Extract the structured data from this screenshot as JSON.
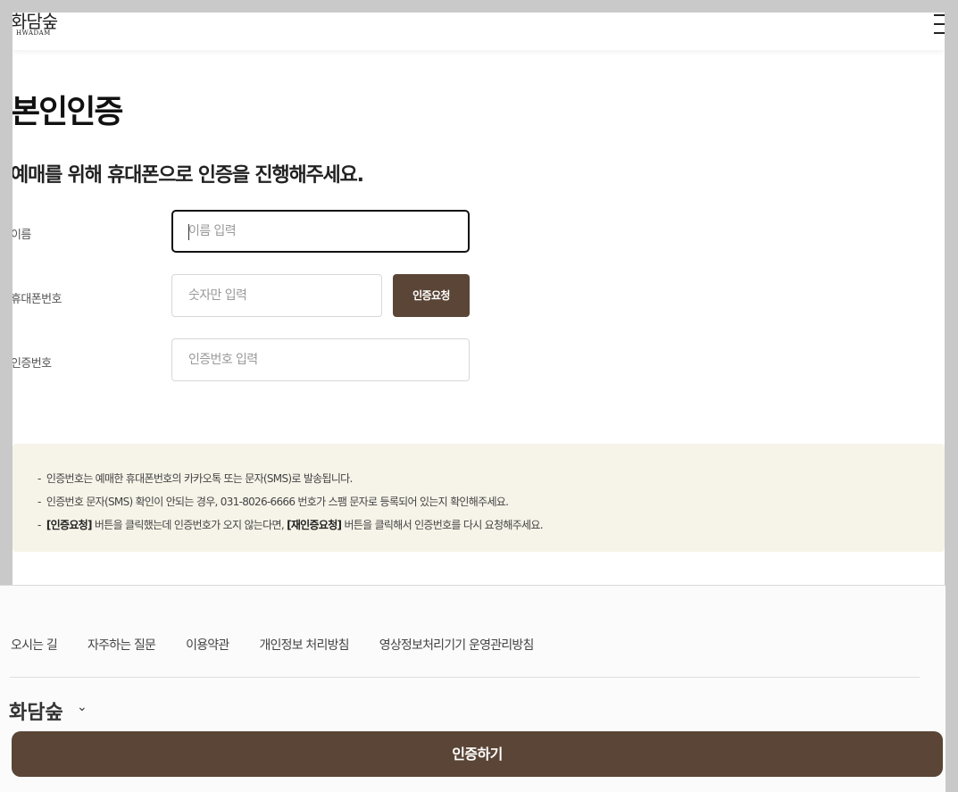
{
  "header": {
    "logo_text": "화담숲",
    "logo_sub": "HWADAM",
    "menu_icon": "hamburger-icon"
  },
  "page": {
    "title": "본인인증",
    "subtitle": "예매를 위해 휴대폰으로 인증을 진행해주세요."
  },
  "form": {
    "name_label": "이름",
    "name_placeholder": "이름 입력",
    "phone_label": "휴대폰번호",
    "phone_placeholder": "숫자만 입력",
    "request_button": "인증요청",
    "code_label": "인증번호",
    "code_placeholder": "인증번호 입력"
  },
  "notice": {
    "line1": "인증번호는 예매한 휴대폰번호의 카카오톡 또는 문자(SMS)로 발송됩니다.",
    "line2": "인증번호 문자(SMS) 확인이 안되는 경우, 031-8026-6666 번호가 스팸 문자로 등록되어 있는지 확인해주세요.",
    "line3_bold1": "[인증요청]",
    "line3_mid": " 버튼을 클릭했는데 인증번호가 오지 않는다면, ",
    "line3_bold2": "[재인증요청]",
    "line3_end": " 버튼을 클릭해서 인증번호를 다시 요청해주세요."
  },
  "footer": {
    "links": [
      "오시는 길",
      "자주하는 질문",
      "이용약관",
      "개인정보 처리방침",
      "영상정보처리기기 운영관리방침"
    ],
    "brand": "화담숲"
  },
  "cta": {
    "label": "인증하기"
  },
  "colors": {
    "brand_brown": "#5a4536",
    "notice_bg": "#f6f3e8"
  }
}
